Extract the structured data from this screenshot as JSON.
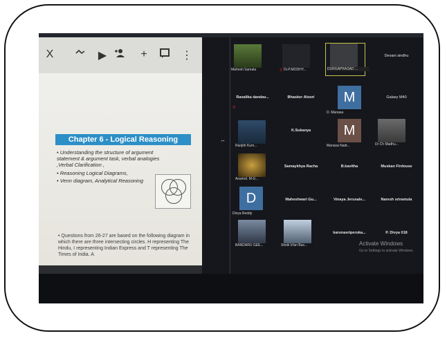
{
  "toolbar": {
    "close": "X",
    "play": "▶",
    "add": "+",
    "more": "⋮"
  },
  "slide": {
    "chapter_title": "Chapter 6 - Logical Reasoning",
    "bullets": [
      "• Understanding the structure of argument statement & argument task, verbal analogies ,Verbal Clarification ,",
      "• Reasoning Logical Diagrams,",
      "• Venn diagram, Analytical Reasoning"
    ],
    "question": "• Questions from 26-27 are based on the following diagram in which there are three intersecting circles. H representing The Hindu, I representing Indian Express and T representing The Times of India. A"
  },
  "participants": {
    "row1": {
      "p1": "Mahesh Samala",
      "p2": "Dr.P.MODHY...",
      "p3": "DURGAPRASAD ...",
      "p4": "Devani sindhu"
    },
    "row2": {
      "p1": "Ravalika dandav...",
      "p2": "Bhasker Aloori",
      "p3_letter": "M",
      "p3": "D. Manasa",
      "p4": "Galaxy M40"
    },
    "row3": {
      "p1": "Ranjith Kum...",
      "p2": "K.Sukanya",
      "p3_letter": "M",
      "p3": "Manasa Nadi...",
      "p4": "Dr Ch Madhu..."
    },
    "row4": {
      "p1": "Aravind. M-G...",
      "p2": "Samaykhya Racha",
      "p3": "B.kavitha",
      "p4": "Muskan Firdouse"
    },
    "row5": {
      "p1_letter": "D",
      "p1": "Divya Reddy",
      "p2": "Maheshwari Gu...",
      "p3": "Vinaya Jerusale...",
      "p4": "Naresh sriramula"
    },
    "row6": {
      "p1": "BANDARU GEE...",
      "p2": "Sheik Irfan Bas...",
      "p3": "karunasriperuka...",
      "p4": "P. Divya 018"
    }
  },
  "watermark": {
    "title": "Activate Windows",
    "subtitle": "Go to Settings to activate Windows."
  },
  "colors": {
    "chapter_banner": "#2d8fc7",
    "mic_muted": "#e02020",
    "avatar_blue": "#3f6fa0",
    "avatar_brown": "#6b5048",
    "highlight_border": "#c8c64a"
  }
}
